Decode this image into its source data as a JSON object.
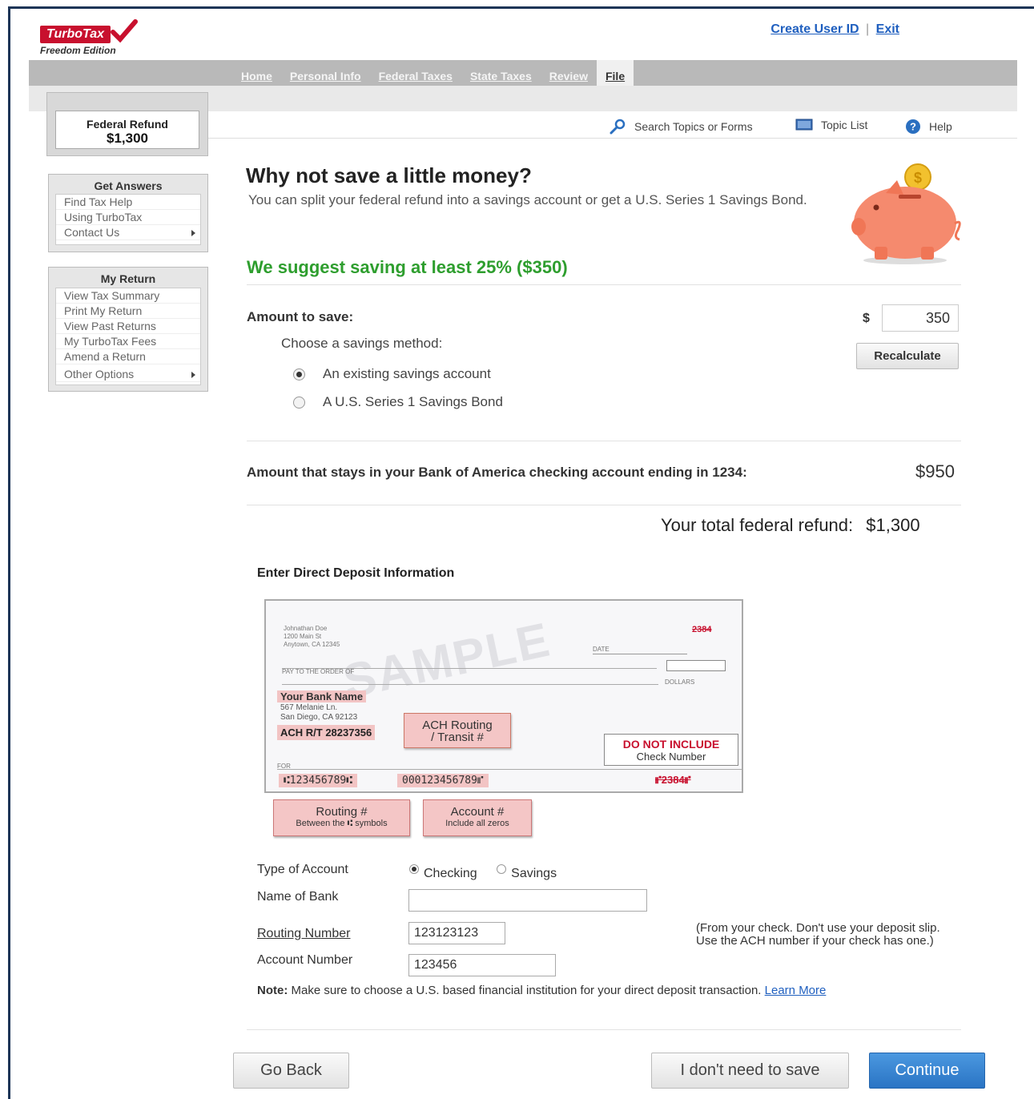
{
  "brand": {
    "logo_text": "TurboTax",
    "edition": "Freedom Edition"
  },
  "top_links": {
    "create_user_id": "Create User ID",
    "separator": "|",
    "exit": "Exit"
  },
  "nav": {
    "tabs": [
      {
        "label": "Home",
        "active": false
      },
      {
        "label": "Personal Info",
        "active": false
      },
      {
        "label": "Federal Taxes",
        "active": false
      },
      {
        "label": "State Taxes",
        "active": false
      },
      {
        "label": "Review",
        "active": false
      },
      {
        "label": "File",
        "active": true
      }
    ]
  },
  "refund_box": {
    "label": "Federal Refund",
    "amount": "$1,300"
  },
  "utility_bar": {
    "search": "Search Topics or Forms",
    "topic_list": "Topic List",
    "help": "Help"
  },
  "sidebar": {
    "get_answers": {
      "title": "Get Answers",
      "items": [
        "Find Tax Help",
        "Using TurboTax",
        "Contact Us"
      ]
    },
    "my_return": {
      "title": "My Return",
      "items": [
        "View Tax Summary",
        "Print My Return",
        "View Past Returns",
        "My TurboTax Fees",
        "Amend a Return",
        "Other Options"
      ]
    }
  },
  "main": {
    "title": "Why not save a little money?",
    "intro": "You can split your federal refund into a savings account or get a U.S. Series 1 Savings Bond.",
    "suggestion": "We suggest saving at least 25% ($350)",
    "amount_label": "Amount to save:",
    "currency": "$",
    "amount_value": "350",
    "recalculate": "Recalculate",
    "choose_method": "Choose a savings method:",
    "methods": [
      {
        "label": "An existing savings account",
        "selected": true
      },
      {
        "label": "A U.S. Series 1 Savings Bond",
        "selected": false
      }
    ],
    "stays_label": "Amount that stays in your Bank of America checking account ending in 1234:",
    "stays_value": "$950",
    "total_label": "Your total federal refund:",
    "total_value": "$1,300"
  },
  "direct_deposit": {
    "title": "Enter Direct Deposit Information",
    "check": {
      "watermark": "SAMPLE",
      "owner_lines": [
        "Johnathan Doe",
        "1200 Main St",
        "Anytown, CA 12345"
      ],
      "check_no_top": "2384",
      "date_label": "DATE",
      "pay_to": "PAY TO THE ORDER OF",
      "dollars": "DOLLARS",
      "bank_name": "Your Bank Name",
      "bank_address": [
        "567 Melanie Ln.",
        "San Diego, CA 92123"
      ],
      "ach_rt": "ACH R/T 28237356",
      "ach_callout": [
        "ACH Routing",
        "/ Transit #"
      ],
      "do_not_include": "DO NOT INCLUDE",
      "check_number_label": "Check Number",
      "for_label": "FOR",
      "micr_routing": "⑆123456789⑆",
      "micr_account": "000123456789⑈",
      "micr_check": "⑈2384⑈",
      "routing_callout": {
        "title": "Routing #",
        "sub": "Between the ⑆ symbols"
      },
      "account_callout": {
        "title": "Account #",
        "sub": "Include all zeros"
      }
    },
    "type_label": "Type of Account",
    "type_options": [
      {
        "label": "Checking",
        "selected": true
      },
      {
        "label": "Savings",
        "selected": false
      }
    ],
    "bank_name_label": "Name of Bank",
    "bank_name_value": "",
    "routing_label": "Routing Number",
    "routing_value": "123123123",
    "account_label": "Account Number",
    "account_value": "123456",
    "hint_lines": [
      "(From your check. Don't use your deposit slip.",
      "Use the ACH number if your check has one.)"
    ],
    "note_prefix": "Note:",
    "note_text": "Make sure to choose a U.S. based financial institution for your direct deposit transaction.",
    "learn_more": "Learn More"
  },
  "footer_buttons": {
    "back": "Go Back",
    "no_save": "I don't need to save",
    "continue": "Continue"
  },
  "colors": {
    "brand_red": "#c8102e",
    "suggest_green": "#2e9e2e",
    "link_blue": "#1f5fbf",
    "continue_blue": "#2a74c4"
  }
}
